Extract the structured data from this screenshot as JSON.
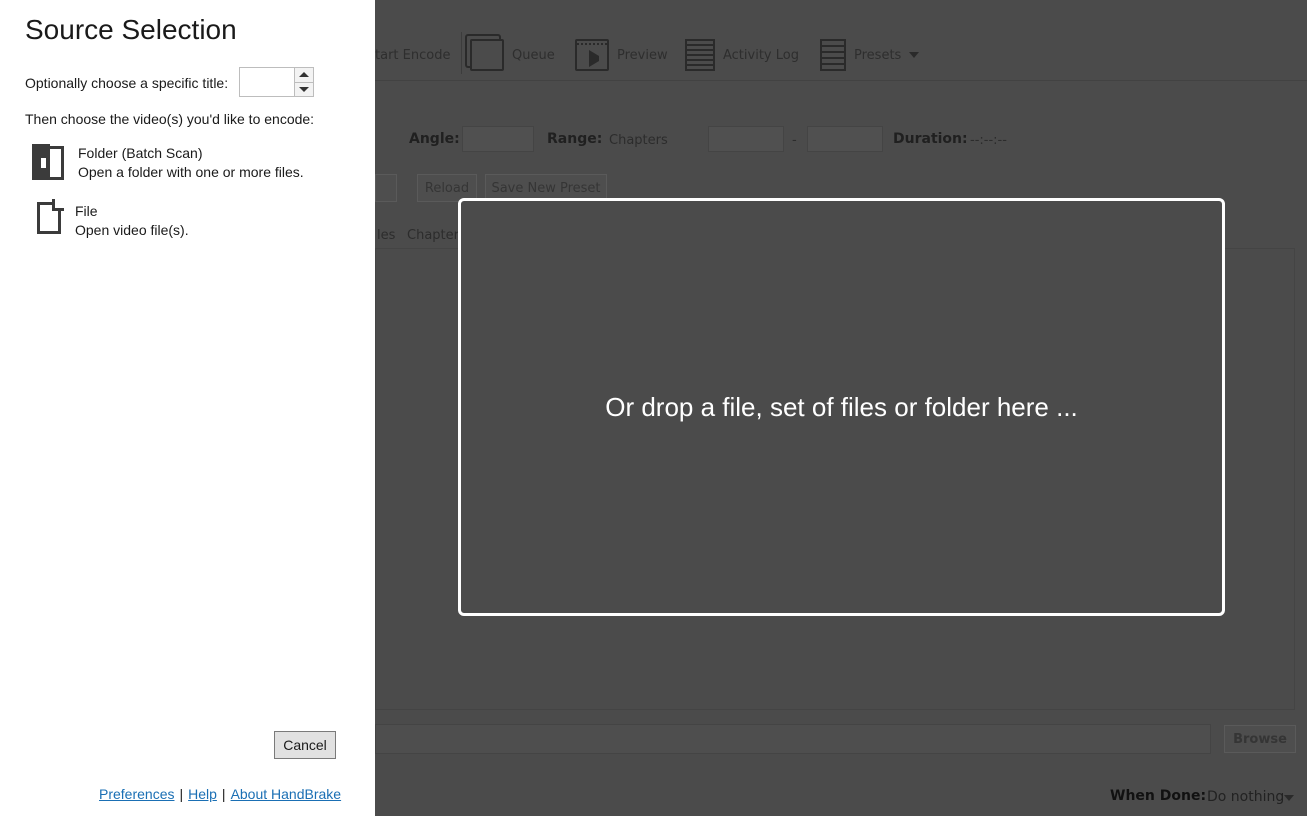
{
  "panel": {
    "title": "Source Selection",
    "title_prompt": "Optionally choose a specific title:",
    "title_value": "",
    "choose_prompt": "Then choose the video(s) you'd like to encode:",
    "options": [
      {
        "icon": "folder-icon",
        "label": "Folder (Batch Scan)",
        "desc": "Open a folder with one or more files."
      },
      {
        "icon": "file-icon",
        "label": "File",
        "desc": "Open video file(s)."
      }
    ],
    "cancel_label": "Cancel",
    "links": {
      "preferences": "Preferences",
      "help": "Help",
      "about": "About HandBrake",
      "separator": "|"
    }
  },
  "dropzone": {
    "text": "Or drop a file, set of files or folder here ..."
  },
  "background": {
    "toolbar": {
      "start_encode": "tart Encode",
      "queue": "Queue",
      "preview": "Preview",
      "activity_log": "Activity Log",
      "presets": "Presets"
    },
    "source_row": {
      "angle_label": "Angle:",
      "range_label": "Range:",
      "range_value": "Chapters",
      "range_dash": "-",
      "duration_label": "Duration:",
      "duration_value": "--:--:--"
    },
    "preset_buttons": {
      "reload": "Reload",
      "save_new": "Save New Preset"
    },
    "tabs": {
      "partial": "les",
      "chapters": "Chapters"
    },
    "browse_label": "Browse",
    "when_done_label": "When Done:",
    "when_done_value": "Do nothing"
  }
}
